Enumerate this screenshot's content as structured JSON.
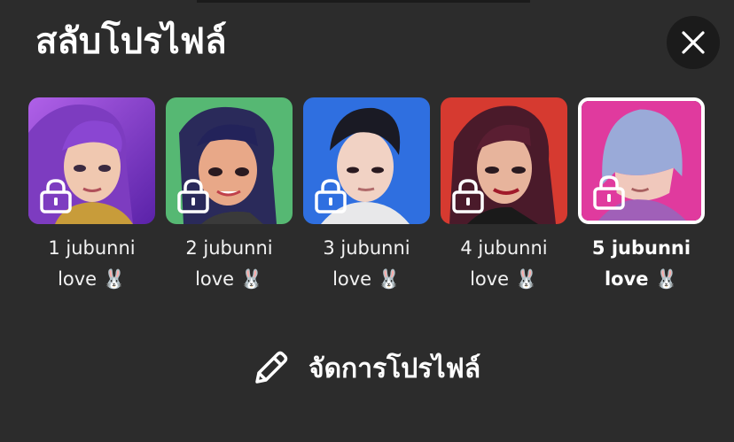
{
  "header": {
    "title": "สลับโปรไฟล์",
    "close_icon": "close-icon"
  },
  "profiles": [
    {
      "name": "1 jubunni\nlove 🐰",
      "locked": true,
      "selected": false,
      "bg": "#7a3fc8"
    },
    {
      "name": "2 jubunni\nlove 🐰",
      "locked": true,
      "selected": false,
      "bg": "#4fb06a"
    },
    {
      "name": "3 jubunni\nlove 🐰",
      "locked": true,
      "selected": false,
      "bg": "#2f6fe0"
    },
    {
      "name": "4 jubunni\nlove 🐰",
      "locked": true,
      "selected": false,
      "bg": "#d62f2a"
    },
    {
      "name": "5 jubunni\nlove 🐰",
      "locked": true,
      "selected": true,
      "bg": "#e03a9e"
    }
  ],
  "manage": {
    "label": "จัดการโปรไฟล์",
    "icon": "pencil-icon"
  }
}
